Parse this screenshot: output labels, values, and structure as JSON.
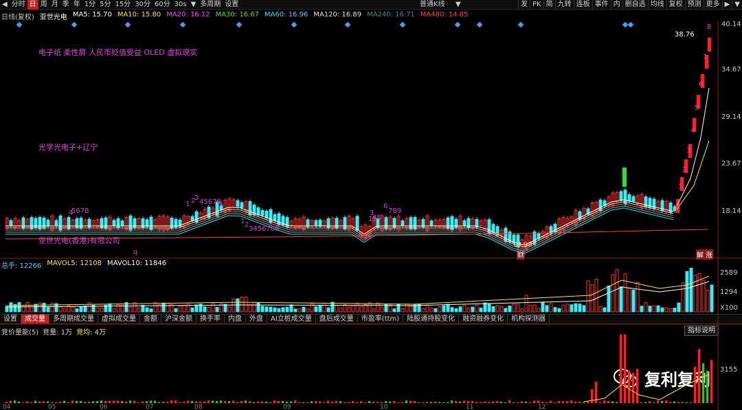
{
  "toolbar": {
    "left_items": [
      "分时",
      "日",
      "周",
      "月",
      "季",
      "年",
      "1分",
      "5分",
      "15分",
      "30分",
      "60分",
      "30s",
      "多周期",
      "设置"
    ],
    "active_item": "日",
    "center_label": "普通K线",
    "right_items": [
      "发",
      "PK",
      "简",
      "九转",
      "连板",
      "事件",
      "内",
      "删自选",
      "均线",
      "复权",
      "预测",
      "更多"
    ]
  },
  "chart_header": {
    "period_label": "日线(复权)",
    "stock_name": "亚世光电",
    "ma_values": [
      {
        "label": "MA5: 15.70",
        "color": "#ffffff"
      },
      {
        "label": "MA10: 15.80",
        "color": "#ffe640"
      },
      {
        "label": "MA20: 16.12",
        "color": "#ff40ff"
      },
      {
        "label": "MA30: 16.67",
        "color": "#40e040"
      },
      {
        "label": "MA60: 16.96",
        "color": "#40d0ff"
      },
      {
        "label": "MA120: 16.89",
        "color": "#e0e0e0"
      },
      {
        "label": "MA240: 16.71",
        "color": "#3a8a8a"
      },
      {
        "label": "MA480: 14.85",
        "color": "#ff4040"
      }
    ]
  },
  "price_scale": [
    "40.14",
    "34.67",
    "29.14",
    "23.67",
    "18.14"
  ],
  "annotations": {
    "concepts": "电子纸 柔性屏 人民币贬值受益 OLED 虚拟现实",
    "theme": "光学光电子+辽宁",
    "company": "亚世光电(香港)有限公司",
    "high_label": "38.76",
    "low_label": "13.98",
    "marker_cai": "财",
    "marker_right": "解 涨",
    "q_marker": "q"
  },
  "volume": {
    "header": [
      {
        "label": "总手: 12266",
        "color": "#40d0ff"
      },
      {
        "label": "MAVOL5: 12108",
        "color": "#ffe640"
      },
      {
        "label": "MAVOL10: 11846",
        "color": "#ffffff"
      }
    ],
    "scale": [
      "2589",
      "1294",
      "X100"
    ]
  },
  "tabs": [
    "设置",
    "成交量",
    "多周期成交量",
    "虚拟成交量",
    "金额",
    "沪深金额",
    "换手率",
    "内盘",
    "外盘",
    "AI立桩成交量",
    "盘后成交量",
    "市盈率(ttm)",
    "陆股通持股变化",
    "融资融券变化",
    "机构探测器"
  ],
  "active_tab": "成交量",
  "auction": {
    "header": [
      {
        "label": "竞价量能(5)",
        "color": "#d0d0d0"
      },
      {
        "label": "竞量: 1万",
        "color": "#d0d0d0"
      },
      {
        "label": "竞均: 4万",
        "color": "#ffe640"
      }
    ],
    "help_label": "指标说明",
    "scale": [
      "3155"
    ]
  },
  "x_axis": [
    "04",
    "05",
    "06",
    "07",
    "08",
    "09",
    "10",
    "11",
    "12"
  ],
  "watermark": "复利复利",
  "colors": {
    "up": "#ff2020",
    "down": "#40e8f0",
    "accent": "#c81e1e"
  }
}
